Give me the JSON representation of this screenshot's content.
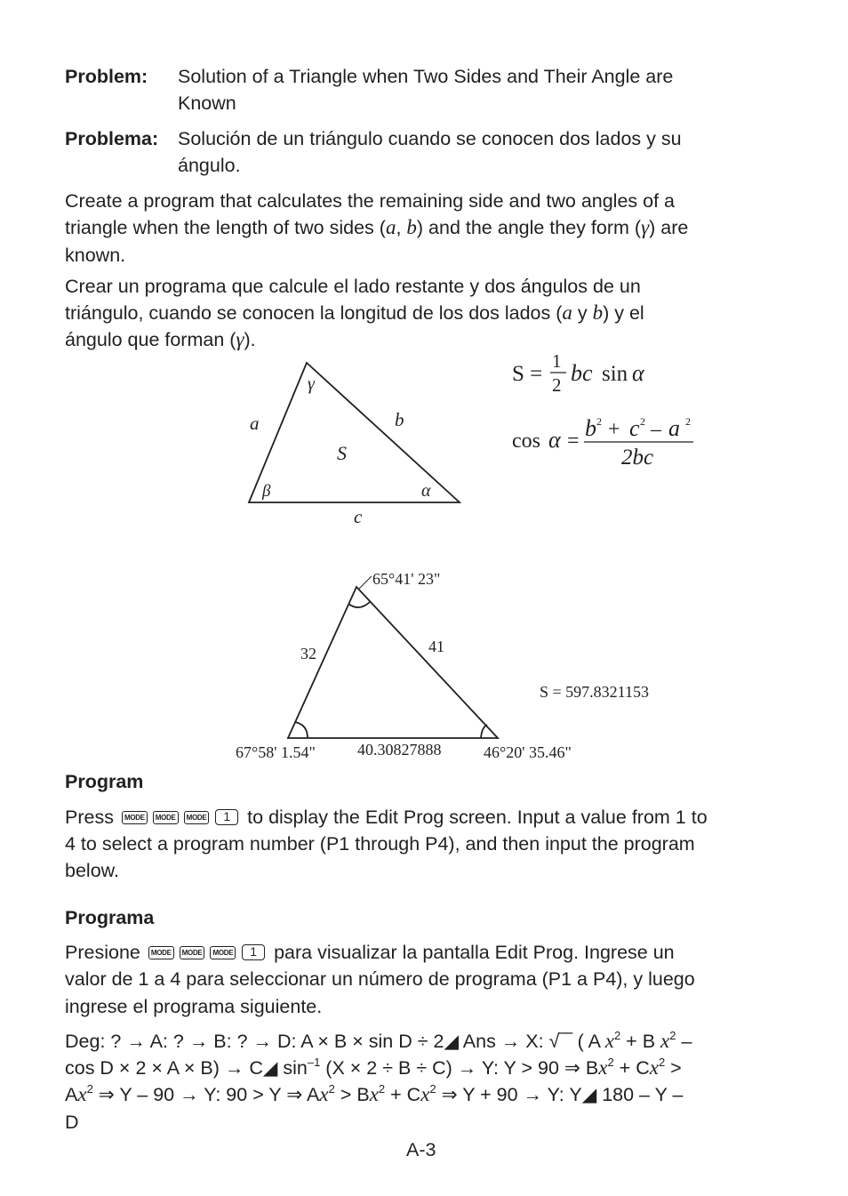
{
  "problem": {
    "label": "Problem:",
    "text_line1": "Solution of a Triangle when Two Sides and Their Angle are",
    "text_line2": "Known"
  },
  "problema": {
    "label": "Problema:",
    "text_line1": "Solución de un triángulo cuando se conocen dos lados y su",
    "text_line2": "ángulo."
  },
  "intro_en": {
    "line1": "Create a program that calculates the remaining side and two angles of a",
    "line2_pre": "triangle when the length of two sides (",
    "var_a": "a",
    "comma": ", ",
    "var_b": "b",
    "line2_mid": ") and the angle they form (",
    "var_gamma": "γ",
    "line2_post": ") are",
    "line3": "known."
  },
  "intro_es": {
    "line1": "Crear un programa que calcule el lado restante y dos ángulos de un",
    "line2_pre": "triángulo, cuando se conocen la longitud de los dos lados (",
    "var_a": "a",
    "y": " y ",
    "var_b": "b",
    "line2_post": ") y el",
    "line3_pre": "ángulo que forman (",
    "var_gamma": "γ",
    "line3_post": ")."
  },
  "diagram1": {
    "side_a": "a",
    "side_b": "b",
    "side_c": "c",
    "area": "S",
    "angle_alpha": "α",
    "angle_beta": "β",
    "angle_gamma": "γ"
  },
  "formulas": {
    "area_lhs": "S =",
    "area_num": "1",
    "area_den": "2",
    "area_rhs_var": "bc",
    "area_rhs_fn": "sin",
    "area_rhs_alpha": "α",
    "cos_lhs_fn": "cos",
    "cos_lhs_alpha": "α",
    "cos_eq": "=",
    "cos_num_b": "b",
    "cos_num_plus": "+",
    "cos_num_c": "c",
    "cos_num_minus": "–",
    "cos_num_a": "a",
    "cos_sq": "2",
    "cos_den": "2bc"
  },
  "diagram2": {
    "top_angle": "65°41' 23\"",
    "left_side": "32",
    "right_side": "41",
    "bottom_side": "40.30827888",
    "left_angle": "67°58' 1.54\"",
    "right_angle": "46°20' 35.46\"",
    "area": "S = 597.8321153"
  },
  "program_en": {
    "heading": "Program",
    "press": "Press",
    "key_mode": "MODE",
    "key_1": "1",
    "line1_post": "to display the Edit Prog screen. Input a value from 1 to",
    "line2": "4 to select a program number (P1 through P4), and then input the program",
    "line3": "below."
  },
  "program_es": {
    "heading": "Programa",
    "press": "Presione",
    "key_mode": "MODE",
    "key_1": "1",
    "line1_post": "para visualizar la pantalla Edit Prog.  Ingrese un",
    "line2": "valor de 1 a 4 para seleccionar un número de programa (P1 a P4), y luego",
    "line3": "ingrese el programa siguiente."
  },
  "code": {
    "l1_a": "Deg: ? → A: ? → B: ? → D: A × B × sin D ÷ 2◢ Ans → X: √‾‾ ( A ",
    "l1_b": " + B ",
    "l1_c": " –",
    "l2_a": "cos D × 2 × A × B) → C◢ sin",
    "l2_sup": "–1",
    "l2_b": " (X × 2 ÷ B ÷ C) → Y: Y > 90 ⇒ B",
    "l2_c": " + C",
    "l2_d": " >",
    "l3_a": "A",
    "l3_b": " ⇒ Y – 90 → Y: 90 > Y ⇒ A",
    "l3_c": " > B",
    "l3_d": " + C",
    "l3_e": " ⇒ Y + 90 → Y: Y◢ 180 – Y –",
    "l4": "D",
    "x": "x",
    "sq": "2"
  },
  "page_number": "A-3"
}
